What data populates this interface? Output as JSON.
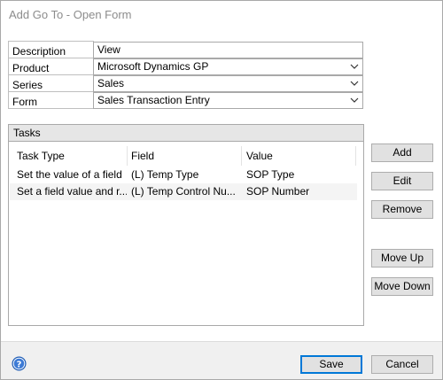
{
  "window": {
    "title": "Add Go To - Open Form"
  },
  "form": {
    "description": {
      "label": "Description",
      "value": "View"
    },
    "product": {
      "label": "Product",
      "value": "Microsoft Dynamics GP"
    },
    "series": {
      "label": "Series",
      "value": "Sales"
    },
    "form": {
      "label": "Form",
      "value": "Sales Transaction Entry"
    }
  },
  "tasks": {
    "title": "Tasks",
    "columns": [
      "Task Type",
      "Field",
      "Value"
    ],
    "rows": [
      {
        "task_type": "Set the value of a field",
        "field": "(L) Temp Type",
        "value": "SOP Type"
      },
      {
        "task_type": "Set a field value and r...",
        "field": "(L) Temp Control Nu...",
        "value": "SOP Number"
      }
    ]
  },
  "side_buttons": {
    "add": "Add",
    "edit": "Edit",
    "remove": "Remove",
    "move_up": "Move Up",
    "move_down": "Move Down"
  },
  "footer": {
    "save": "Save",
    "cancel": "Cancel",
    "help_icon": "help-icon"
  },
  "colors": {
    "accent": "#0078d7",
    "help_icon": "#1c5bb5"
  }
}
